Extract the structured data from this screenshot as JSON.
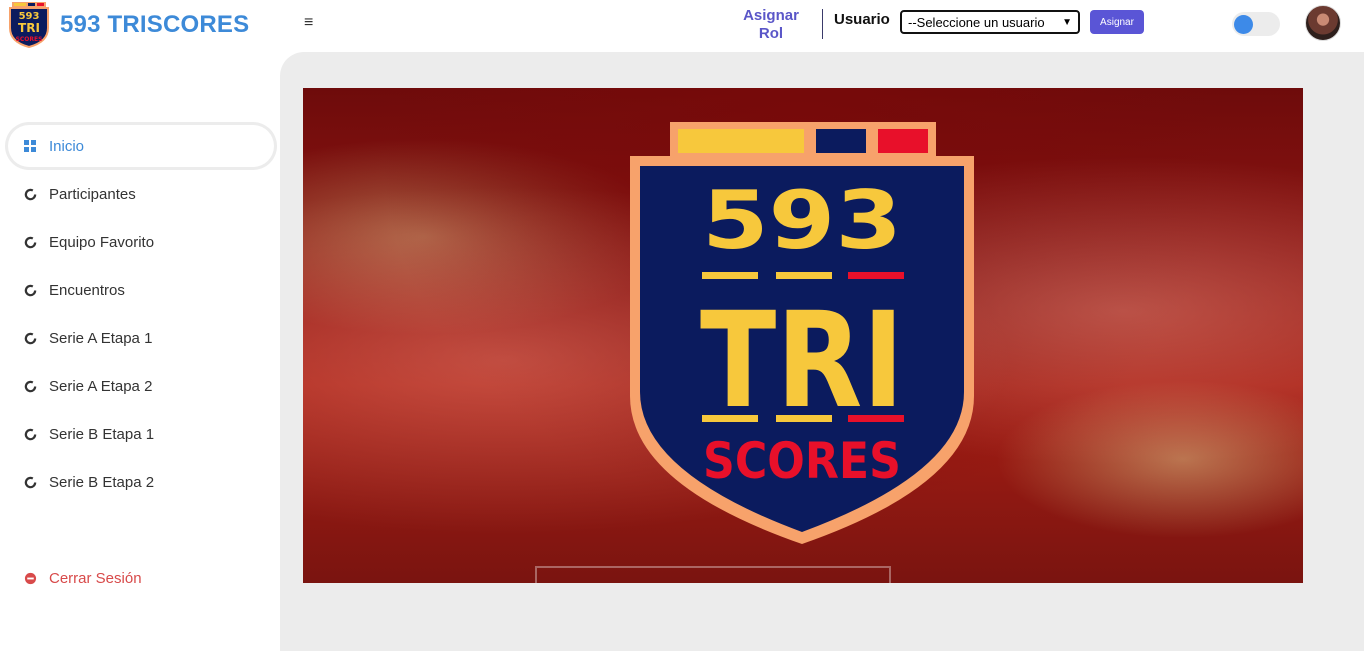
{
  "app": {
    "title": "593 TRISCORES",
    "logo_text": "593 TRI SCORES"
  },
  "header": {
    "menu_icon": "hamburger-icon",
    "assign_role_label": "Asignar Rol",
    "user_label": "Usuario",
    "user_select_value": "--Seleccione un usuario",
    "assign_button_label": "Asignar",
    "toggle_on": false
  },
  "sidebar": {
    "items": [
      {
        "label": "Inicio",
        "icon": "dashboard-grid-icon",
        "active": true
      },
      {
        "label": "Participantes",
        "icon": "loading-circle-icon"
      },
      {
        "label": "Equipo Favorito",
        "icon": "loading-circle-icon"
      },
      {
        "label": "Encuentros",
        "icon": "loading-circle-icon"
      },
      {
        "label": "Serie A Etapa 1",
        "icon": "loading-circle-icon"
      },
      {
        "label": "Serie A Etapa 2",
        "icon": "loading-circle-icon"
      },
      {
        "label": "Serie B Etapa 1",
        "icon": "loading-circle-icon"
      },
      {
        "label": "Serie B Etapa 2",
        "icon": "loading-circle-icon"
      }
    ],
    "logout_label": "Cerrar Sesión",
    "logout_icon": "minus-circle-icon"
  },
  "hero": {
    "crest_line1": "593",
    "crest_line2": "TRI",
    "crest_line3": "SCORES"
  },
  "colors": {
    "brand_blue": "#3d8ad8",
    "accent_purple": "#5a55d6",
    "logout_red": "#d84a4a",
    "crest_navy": "#0b1b5e",
    "crest_yellow": "#f7c83c",
    "crest_red": "#e8102a",
    "crest_border": "#f7a26b"
  }
}
